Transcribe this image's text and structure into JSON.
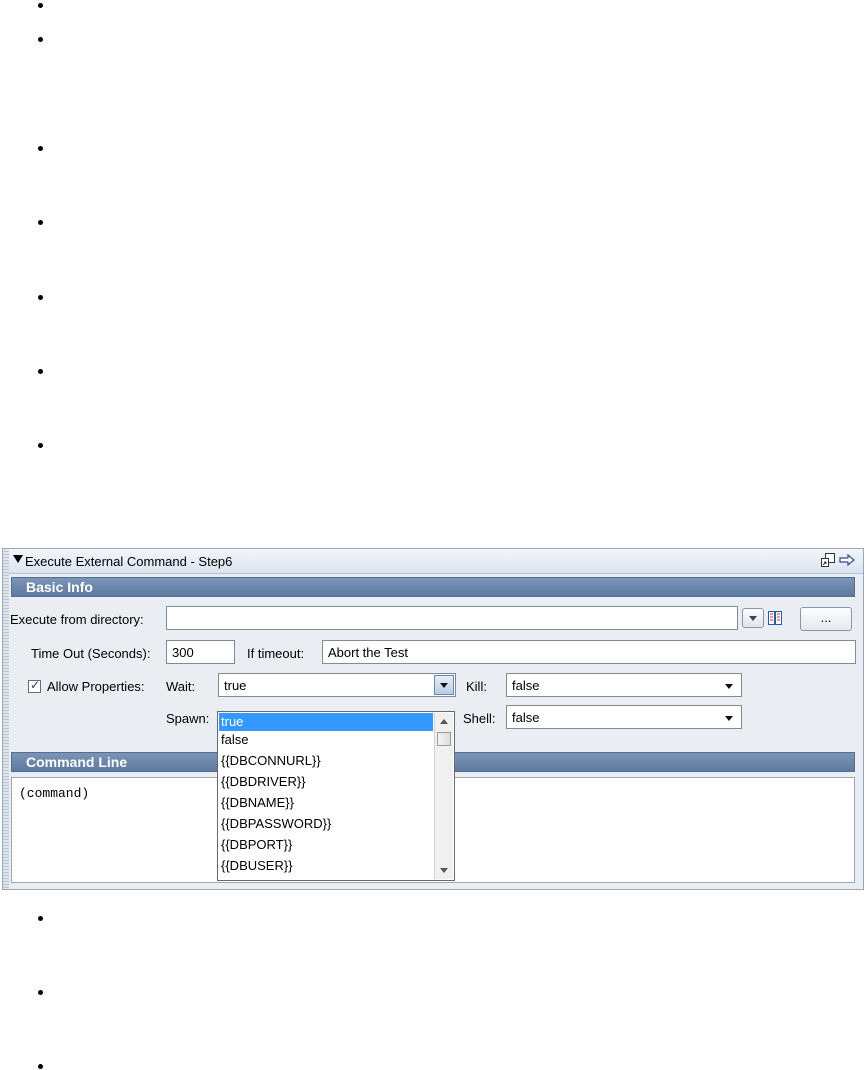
{
  "panel": {
    "title": "Execute External Command - Step6",
    "icons": [
      "restore-icon",
      "forward-arrow-icon"
    ]
  },
  "basic_info": {
    "header": "Basic Info",
    "execute_dir_label": "Execute from directory:",
    "execute_dir_value": "",
    "browse_label": "...",
    "timeout_label": "Time Out (Seconds):",
    "timeout_value": "300",
    "if_timeout_label": "If timeout:",
    "if_timeout_value": "Abort the Test",
    "allow_properties_label": "Allow Properties:",
    "allow_properties_checked": true,
    "wait_label": "Wait:",
    "wait_value": "true",
    "kill_label": "Kill:",
    "kill_value": "false",
    "spawn_label": "Spawn:",
    "shell_label": "Shell:",
    "shell_value": "false"
  },
  "command_line": {
    "header": "Command Line",
    "text": "(command)"
  },
  "wait_dropdown": {
    "options": [
      "true",
      "false",
      "{{DBCONNURL}}",
      "{{DBDRIVER}}",
      "{{DBNAME}}",
      "{{DBPASSWORD}}",
      "{{DBPORT}}",
      "{{DBUSER}}"
    ],
    "selected": "true"
  },
  "colors": {
    "section_header": "#6580a5",
    "selection": "#3399ff",
    "panel_bg": "#eaeef3"
  }
}
